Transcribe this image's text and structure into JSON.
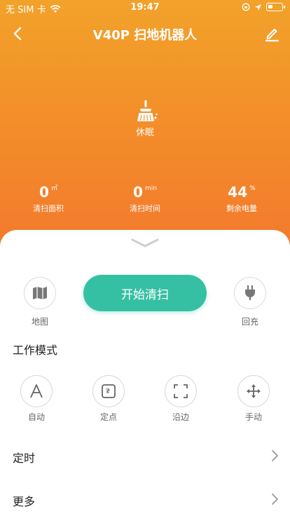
{
  "status_bar": {
    "carrier": "无 SIM 卡",
    "time": "19:47"
  },
  "nav": {
    "title": "V40P 扫地机器人"
  },
  "device": {
    "icon": "broom-icon",
    "status": "休眠"
  },
  "stats": [
    {
      "value": "0",
      "unit": "㎡",
      "label": "清扫面积"
    },
    {
      "value": "0",
      "unit": "min",
      "label": "清扫时间"
    },
    {
      "value": "44",
      "unit": "%",
      "label": "剩余电量"
    }
  ],
  "controls": {
    "map_label": "地图",
    "start_label": "开始清扫",
    "recharge_label": "回充"
  },
  "work_mode": {
    "title": "工作模式",
    "modes": [
      {
        "label": "自动",
        "icon": "letter-a-icon"
      },
      {
        "label": "定点",
        "icon": "spot-icon"
      },
      {
        "label": "沿边",
        "icon": "edge-frame-icon"
      },
      {
        "label": "手动",
        "icon": "move-arrows-icon"
      }
    ]
  },
  "menu": {
    "timer_label": "定时",
    "more_label": "更多"
  },
  "colors": {
    "header_gradient_top": "#f2a22a",
    "header_gradient_bottom": "#f3792e",
    "accent_green": "#36c0a3",
    "icon_gray": "#777777"
  }
}
